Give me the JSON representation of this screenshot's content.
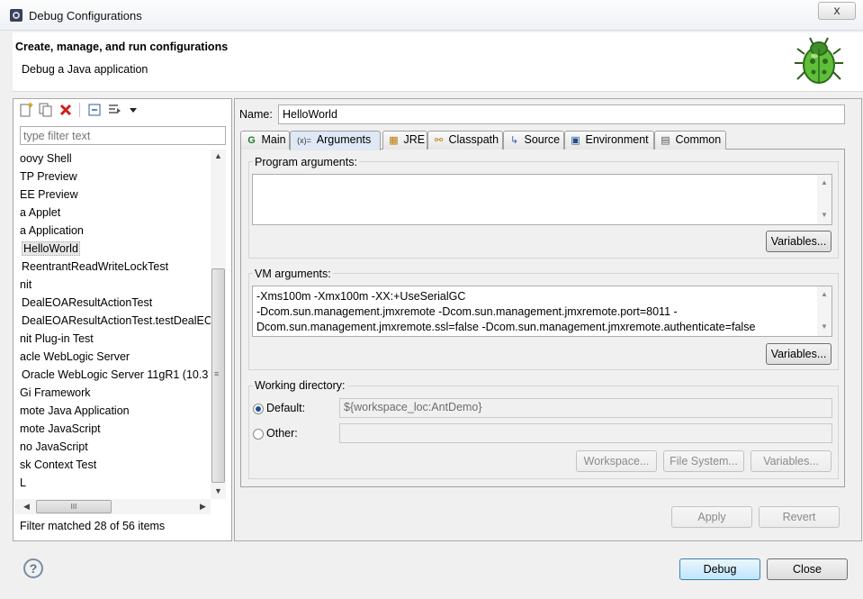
{
  "window": {
    "title": "Debug Configurations",
    "close_glyph": "x"
  },
  "banner": {
    "title": "Create, manage, and run configurations",
    "subtitle": "Debug a Java application"
  },
  "left": {
    "filter_placeholder": "type filter text",
    "tree_items": [
      {
        "label": "oovy Shell",
        "selected": false
      },
      {
        "label": "TP Preview",
        "selected": false
      },
      {
        "label": "EE Preview",
        "selected": false
      },
      {
        "label": "a Applet",
        "selected": false
      },
      {
        "label": "a Application",
        "selected": false
      },
      {
        "label": "HelloWorld",
        "selected": true
      },
      {
        "label": "ReentrantReadWriteLockTest",
        "selected": false
      },
      {
        "label": "nit",
        "selected": false
      },
      {
        "label": "DealEOAResultActionTest",
        "selected": false
      },
      {
        "label": "DealEOAResultActionTest.testDealEC",
        "selected": false
      },
      {
        "label": "nit Plug-in Test",
        "selected": false
      },
      {
        "label": "acle WebLogic Server",
        "selected": false
      },
      {
        "label": "Oracle WebLogic Server 11gR1 (10.3",
        "selected": false
      },
      {
        "label": "Gi Framework",
        "selected": false
      },
      {
        "label": "mote Java Application",
        "selected": false
      },
      {
        "label": "mote JavaScript",
        "selected": false
      },
      {
        "label": "no JavaScript",
        "selected": false
      },
      {
        "label": "sk Context Test",
        "selected": false
      },
      {
        "label": "L",
        "selected": false
      }
    ],
    "hscroll_grip": "III",
    "filter_status": "Filter matched 28 of 56 items"
  },
  "right": {
    "name_label": "Name:",
    "name_value": "HelloWorld",
    "tabs": [
      {
        "label": "Main",
        "icon": "main-icon",
        "glyph": "G"
      },
      {
        "label": "Arguments",
        "icon": "arguments-icon",
        "glyph": "(x)="
      },
      {
        "label": "JRE",
        "icon": "jre-icon",
        "glyph": "▦"
      },
      {
        "label": "Classpath",
        "icon": "classpath-icon",
        "glyph": "⚯"
      },
      {
        "label": "Source",
        "icon": "source-icon",
        "glyph": "↳"
      },
      {
        "label": "Environment",
        "icon": "environment-icon",
        "glyph": "▣"
      },
      {
        "label": "Common",
        "icon": "common-icon",
        "glyph": "▤"
      }
    ],
    "program_args": {
      "label": "Program arguments:",
      "value": "",
      "variables": "Variables..."
    },
    "vm_args": {
      "label": "VM arguments:",
      "lines": [
        "-Xms100m -Xmx100m -XX:+UseSerialGC",
        "-Dcom.sun.management.jmxremote  -Dcom.sun.management.jmxremote.port=8011 -",
        "Dcom.sun.management.jmxremote.ssl=false -Dcom.sun.management.jmxremote.authenticate=false"
      ],
      "variables": "Variables..."
    },
    "working_dir": {
      "label": "Working directory:",
      "default_label": "Default:",
      "default_value": "${workspace_loc:AntDemo}",
      "other_label": "Other:",
      "other_value": "",
      "workspace_btn": "Workspace...",
      "filesystem_btn": "File System...",
      "variables_btn": "Variables..."
    },
    "apply": "Apply",
    "revert": "Revert"
  },
  "footer": {
    "help": "?",
    "debug": "Debug",
    "close": "Close"
  },
  "colors": {
    "tab_active": "#dfe9f5",
    "default_button": "#bee6fd"
  }
}
